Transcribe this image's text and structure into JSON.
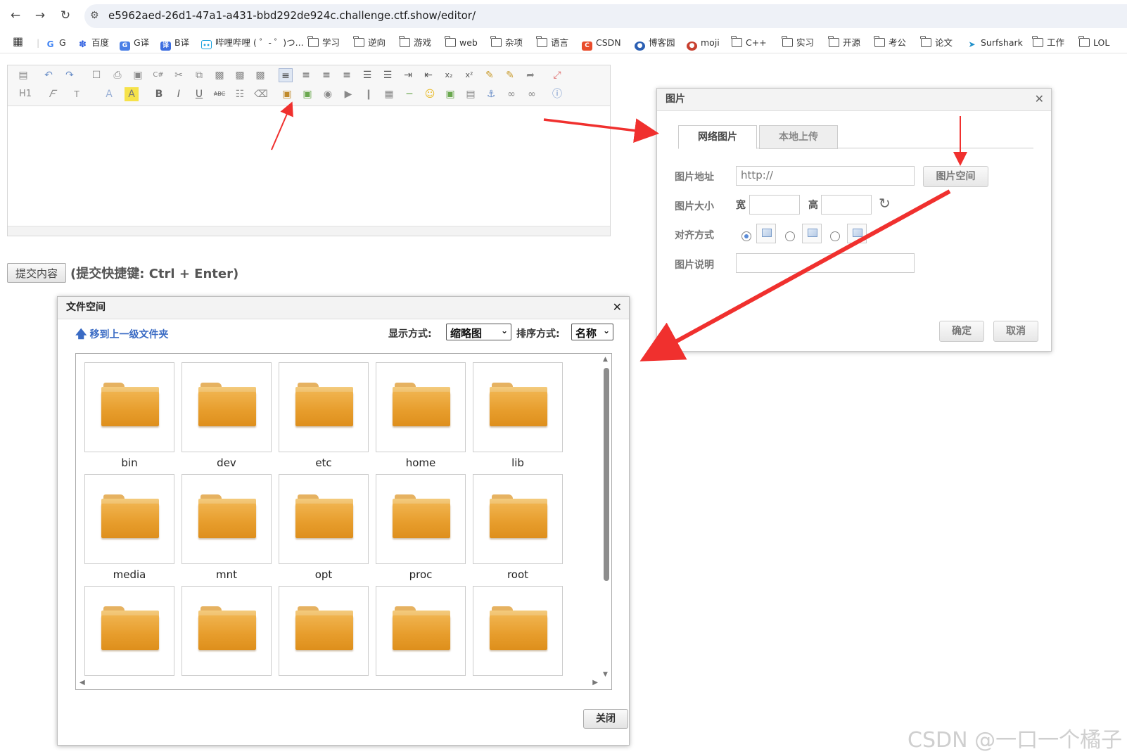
{
  "browser": {
    "url": "e5962aed-26d1-47a1-a431-bbd292de924c.challenge.ctf.show/editor/",
    "bookmarks": [
      "G",
      "百度",
      "G译",
      "B译",
      "哔哩哔哩 ( ゜- ゜)つ...",
      "学习",
      "逆向",
      "游戏",
      "web",
      "杂项",
      "语言",
      "CSDN",
      "博客园",
      "moji",
      "C++",
      "实习",
      "开源",
      "考公",
      "论文",
      "Surfshark",
      "工作",
      "LOL"
    ]
  },
  "editor": {
    "toolbar_row2": [
      "H1",
      "ABC"
    ],
    "submit_button": "提交内容",
    "submit_hint": "(提交快捷键: Ctrl + Enter)"
  },
  "image_dialog": {
    "title": "图片",
    "tabs": [
      "网络图片",
      "本地上传"
    ],
    "url_label": "图片地址",
    "url_value": "http://",
    "space_button": "图片空间",
    "size_label": "图片大小",
    "width_label": "宽",
    "height_label": "高",
    "align_label": "对齐方式",
    "caption_label": "图片说明",
    "ok_button": "确定",
    "cancel_button": "取消"
  },
  "file_dialog": {
    "title": "文件空间",
    "up_folder": "移到上一级文件夹",
    "view_label": "显示方式:",
    "view_value": "缩略图",
    "sort_label": "排序方式:",
    "sort_value": "名称",
    "folders": [
      "bin",
      "dev",
      "etc",
      "home",
      "lib",
      "media",
      "mnt",
      "opt",
      "proc",
      "root",
      "",
      "",
      "",
      "",
      ""
    ],
    "close_button": "关闭"
  },
  "watermark": "CSDN @一口一个橘子",
  "colors": {
    "annotation_arrow": "#f0302e",
    "folder": "#e79d2c",
    "link": "#3a6bc4"
  }
}
